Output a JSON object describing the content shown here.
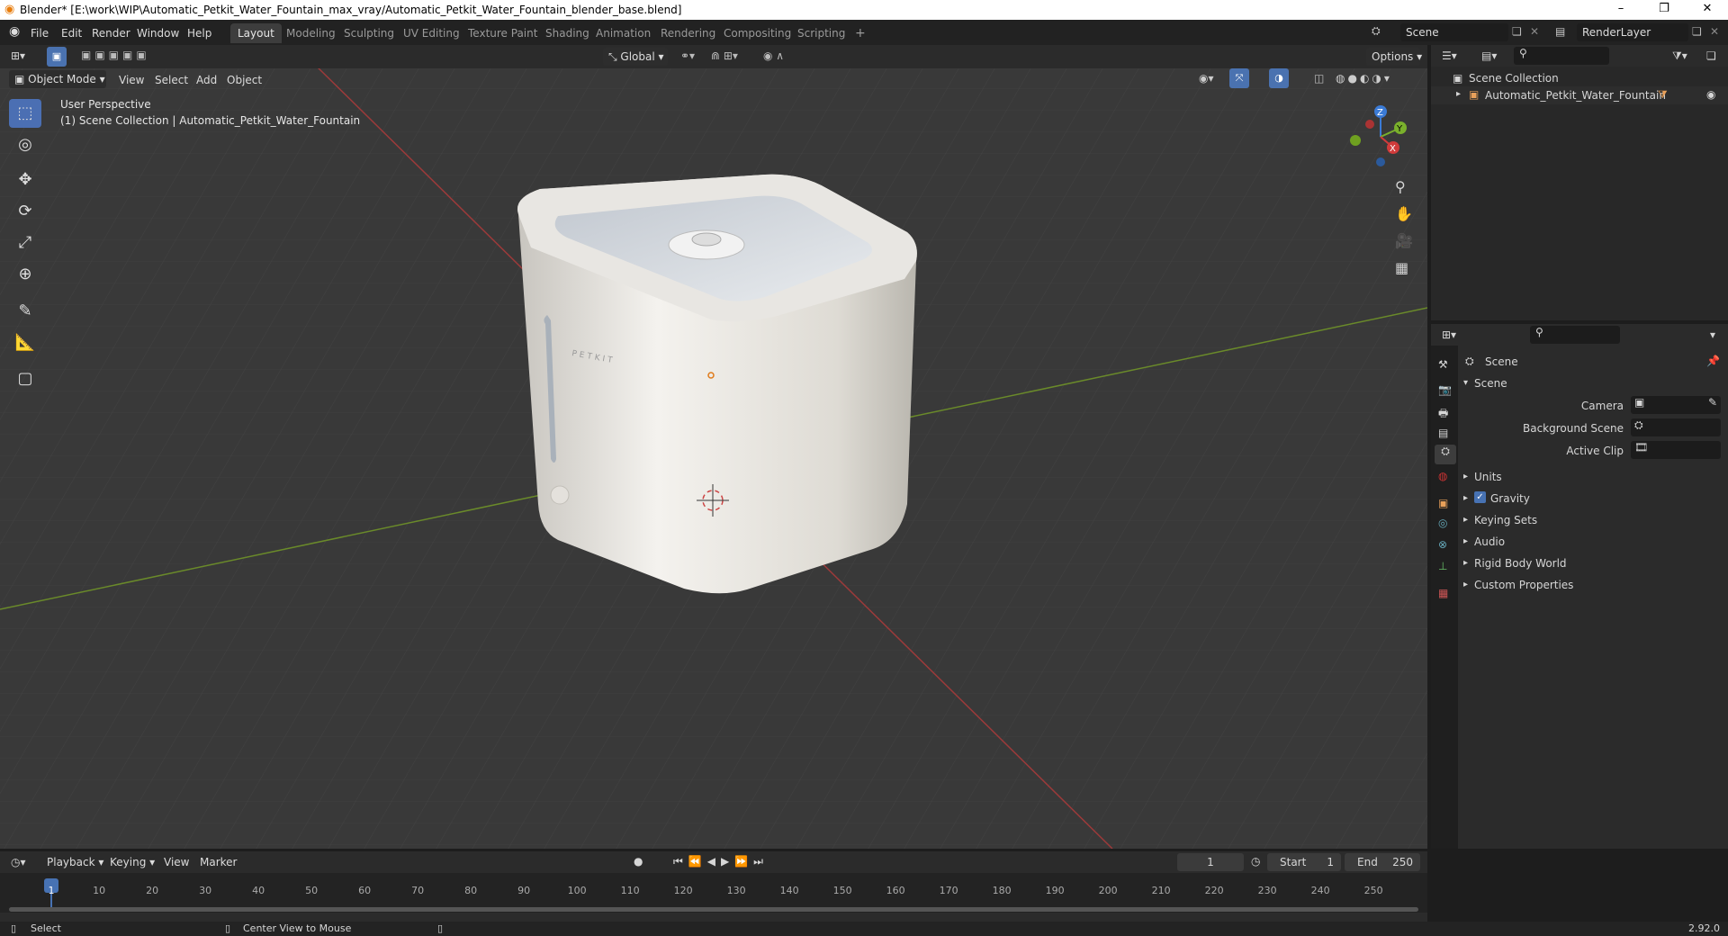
{
  "window": {
    "title": "Blender* [E:\\work\\WIP\\Automatic_Petkit_Water_Fountain_max_vray/Automatic_Petkit_Water_Fountain_blender_base.blend]",
    "minimize": "–",
    "maximize": "❐",
    "close": "✕"
  },
  "menu": [
    "File",
    "Edit",
    "Render",
    "Window",
    "Help"
  ],
  "workspaces": [
    "Layout",
    "Modeling",
    "Sculpting",
    "UV Editing",
    "Texture Paint",
    "Shading",
    "Animation",
    "Rendering",
    "Compositing",
    "Scripting"
  ],
  "add_workspace": "+",
  "scene": {
    "name": "Scene",
    "renderlayer": "RenderLayer"
  },
  "viewport_header": {
    "mode": "Object Mode",
    "view": "View",
    "select": "Select",
    "add": "Add",
    "object": "Object",
    "orientation": "Global",
    "options": "Options"
  },
  "viewport": {
    "perspective": "User Perspective",
    "collection": "(1) Scene Collection | Automatic_Petkit_Water_Fountain",
    "brand": "PETKIT"
  },
  "gizmo": {
    "x": "X",
    "y": "Y",
    "z": "Z"
  },
  "outliner": {
    "collection": "Scene Collection",
    "object": "Automatic_Petkit_Water_Fountain"
  },
  "properties": {
    "context": "Scene",
    "section": "Scene",
    "camera_label": "Camera",
    "bg_label": "Background Scene",
    "clip_label": "Active Clip",
    "panels": [
      "Units",
      "Gravity",
      "Keying Sets",
      "Audio",
      "Rigid Body World",
      "Custom Properties"
    ]
  },
  "timeline": {
    "playback": "Playback",
    "keying": "Keying",
    "view": "View",
    "marker": "Marker",
    "current": "1",
    "start_label": "Start",
    "start": "1",
    "end_label": "End",
    "end": "250",
    "ticks": [
      "1",
      "10",
      "20",
      "30",
      "40",
      "50",
      "60",
      "70",
      "80",
      "90",
      "100",
      "110",
      "120",
      "130",
      "140",
      "150",
      "160",
      "170",
      "180",
      "190",
      "200",
      "210",
      "220",
      "230",
      "240",
      "250"
    ]
  },
  "status": {
    "select": "Select",
    "center": "Center View to Mouse",
    "version": "2.92.0"
  },
  "colors": {
    "accent": "#4772b3",
    "x_axis": "#a33a3a",
    "y_axis": "#6c8f2b",
    "viewport_bg": "#393939"
  }
}
